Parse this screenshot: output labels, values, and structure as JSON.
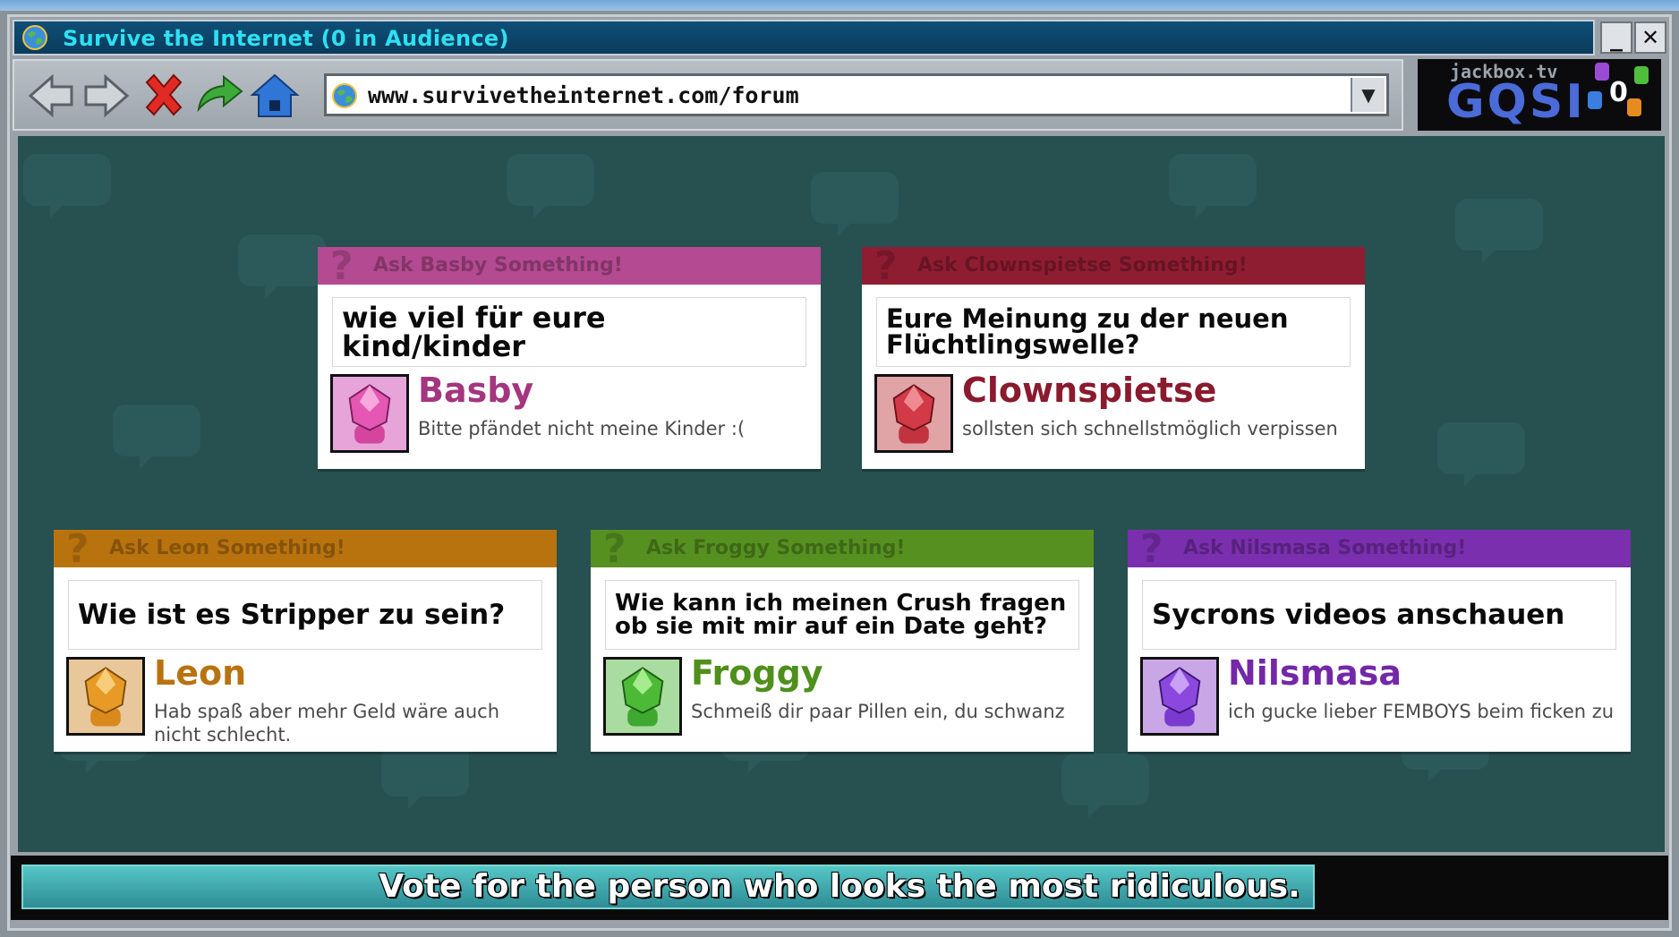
{
  "window": {
    "title": "Survive the Internet  (0 in Audience)",
    "minimize_label": "_",
    "close_label": "✕"
  },
  "browser": {
    "url": "www.survivetheinternet.com/forum",
    "icons": [
      "back-arrow-icon",
      "forward-arrow-icon",
      "stop-x-icon",
      "refresh-arrow-icon",
      "home-icon",
      "globe-icon",
      "dropdown-chevron-icon"
    ]
  },
  "room": {
    "site": "jackbox.tv",
    "code": "GQSI",
    "audience_count": "0"
  },
  "colors": {
    "basby": "#a3367e",
    "basby_header": "#b44a91",
    "clownspietse": "#8a1a2e",
    "clownspietse_header": "#8f1d32",
    "leon": "#b87310",
    "leon_header": "#b9730e",
    "froggy": "#4f8f1c",
    "froggy_header": "#569021",
    "nilsmasa": "#7428a8",
    "nilsmasa_header": "#7a2fae",
    "background": "#275050",
    "progress": "#3fa7aa"
  },
  "cards": [
    {
      "header": "Ask Basby Something!",
      "question": "wie viel für eure kind/kinder",
      "player": "Basby",
      "answer": "Bitte pfändet nicht meine Kinder :("
    },
    {
      "header": "Ask Clownspietse Something!",
      "question": "Eure Meinung zu der neuen Flüchtlingswelle?",
      "player": "Clownspietse",
      "answer": "sollsten sich schnellstmöglich verpissen"
    },
    {
      "header": "Ask Leon Something!",
      "question": "Wie ist es Stripper zu sein?",
      "player": "Leon",
      "answer": "Hab spaß aber mehr Geld wäre auch nicht schlecht."
    },
    {
      "header": "Ask Froggy Something!",
      "question": "Wie kann ich meinen Crush fragen ob sie mit mir auf ein Date geht?",
      "player": "Froggy",
      "answer": "Schmeiß dir paar Pillen ein, du schwanz"
    },
    {
      "header": "Ask Nilsmasa Something!",
      "question": "Sycrons videos anschauen",
      "player": "Nilsmasa",
      "answer": "ich gucke lieber FEMBOYS beim ficken zu"
    }
  ],
  "footer": {
    "instruction": "Vote for the person who looks the most ridiculous.",
    "timer_fraction": 0.85
  }
}
